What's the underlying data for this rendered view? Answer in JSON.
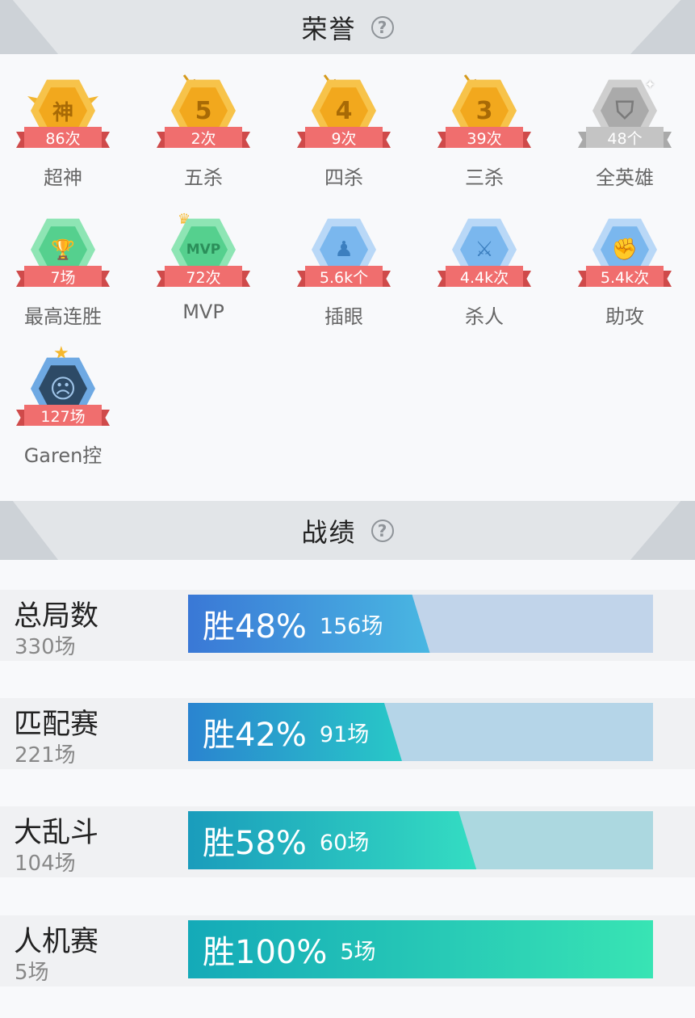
{
  "honor": {
    "title": "荣誉",
    "help_icon": "?",
    "badges": [
      {
        "icon_text": "神",
        "count": "86次",
        "label": "超神",
        "theme": "gold",
        "icon": "godlike-badge-icon"
      },
      {
        "icon_text": "5",
        "count": "2次",
        "label": "五杀",
        "theme": "gold",
        "icon": "pentakill-badge-icon"
      },
      {
        "icon_text": "4",
        "count": "9次",
        "label": "四杀",
        "theme": "gold",
        "icon": "quadrakill-badge-icon"
      },
      {
        "icon_text": "3",
        "count": "39次",
        "label": "三杀",
        "theme": "gold",
        "icon": "triplekill-badge-icon"
      },
      {
        "icon_text": "⛉",
        "count": "48个",
        "label": "全英雄",
        "theme": "grey",
        "icon": "all-heroes-badge-icon"
      },
      {
        "icon_text": "🏆",
        "count": "7场",
        "label": "最高连胜",
        "theme": "green",
        "icon": "win-streak-trophy-icon"
      },
      {
        "icon_text": "MVP",
        "count": "72次",
        "label": "MVP",
        "theme": "green",
        "icon": "mvp-badge-icon"
      },
      {
        "icon_text": "♟",
        "count": "5.6k个",
        "label": "插眼",
        "theme": "blue",
        "icon": "ward-badge-icon"
      },
      {
        "icon_text": "⚔",
        "count": "4.4k次",
        "label": "杀人",
        "theme": "blue",
        "icon": "kills-badge-icon"
      },
      {
        "icon_text": "✊",
        "count": "5.4k次",
        "label": "助攻",
        "theme": "blue",
        "icon": "assist-badge-icon"
      },
      {
        "icon_text": "☹",
        "count": "127场",
        "label": "Garen控",
        "theme": "hero",
        "icon": "garen-portrait-icon"
      }
    ]
  },
  "record": {
    "title": "战绩",
    "help_icon": "?",
    "rows": [
      {
        "name": "总局数",
        "games": "330场",
        "win_label": "胜48%",
        "wins": "156场",
        "win_rate": 0.48,
        "track_color": "#c1d4ea",
        "fill_from": "#3a78d6",
        "fill_to": "#49b7e2"
      },
      {
        "name": "匹配赛",
        "games": "221场",
        "win_label": "胜42%",
        "wins": "91场",
        "win_rate": 0.42,
        "track_color": "#b5d5e8",
        "fill_from": "#2a84d0",
        "fill_to": "#28c9c7"
      },
      {
        "name": "大乱斗",
        "games": "104场",
        "win_label": "胜58%",
        "wins": "60场",
        "win_rate": 0.58,
        "track_color": "#acd8e0",
        "fill_from": "#1a9cbc",
        "fill_to": "#34ddc2"
      },
      {
        "name": "人机赛",
        "games": "5场",
        "win_label": "胜100%",
        "wins": "5场",
        "win_rate": 1.0,
        "track_color": "#b3e6da",
        "fill_from": "#14aab8",
        "fill_to": "#38e4b4"
      }
    ]
  }
}
